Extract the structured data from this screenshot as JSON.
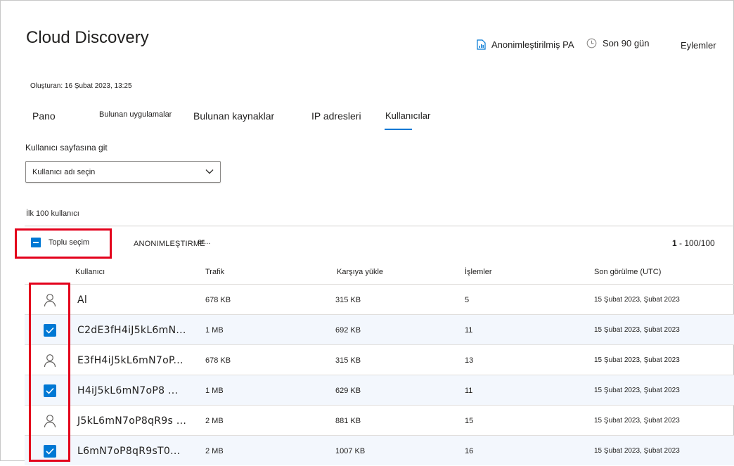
{
  "page": {
    "title": "Cloud Discovery",
    "created": "Oluşturan: 16 Şubat 2023, 13:25"
  },
  "header": {
    "report_label": "Anonimleştirilmiş PA",
    "period_label": "Son 90 gün",
    "actions_label": "Eylemler"
  },
  "tabs": [
    {
      "label": "Pano"
    },
    {
      "label": "Bulunan uygulamalar"
    },
    {
      "label": "Bulunan kaynaklar"
    },
    {
      "label": "IP adresleri"
    },
    {
      "label": "Kullanıcılar",
      "active": true
    }
  ],
  "goto": {
    "label": "Kullanıcı sayfasına git",
    "select_value": "Kullanıcı adı seçin"
  },
  "list": {
    "heading": "İlk 100 kullanıcı",
    "bulk_select_label": "Toplu seçim",
    "anonymize_label": "ANONIMLEŞTIRME",
    "more_fragment": "er...",
    "pager_current": "1",
    "pager_rest": " - 100/100"
  },
  "columns": {
    "user": "Kullanıcı",
    "traffic": "Trafik",
    "upload": "Karşıya yükle",
    "transactions": "İşlemler",
    "last_seen": "Son görülme (UTC)"
  },
  "rows": [
    {
      "user": "Al",
      "traffic": "678 KB",
      "upload": "315 KB",
      "transactions": "5",
      "last_seen": "15 Şubat 2023, Şubat 2023",
      "selected": false
    },
    {
      "user": "C2dE3fH4iJ5kL6mN...",
      "traffic": "1 MB",
      "upload": "692 KB",
      "transactions": "11",
      "last_seen": "15 Şubat 2023, Şubat 2023",
      "selected": true
    },
    {
      "user": "E3fH4iJ5kL6mN7oP...",
      "traffic": "678 KB",
      "upload": "315 KB",
      "transactions": "13",
      "last_seen": "15 Şubat 2023, Şubat 2023",
      "selected": false
    },
    {
      "user": "H4iJ5kL6mN7oP8 ...",
      "traffic": "1 MB",
      "upload": "629 KB",
      "transactions": "11",
      "last_seen": "15 Şubat 2023, Şubat 2023",
      "selected": true
    },
    {
      "user": "J5kL6mN7oP8qR9s ...",
      "traffic": "2 MB",
      "upload": "881 KB",
      "transactions": "15",
      "last_seen": "15 Şubat 2023, Şubat 2023",
      "selected": false
    },
    {
      "user": "L6mN7oP8qR9sT0...",
      "traffic": "2 MB",
      "upload": "1007 KB",
      "transactions": "16",
      "last_seen": "15 Şubat 2023, Şubat 2023",
      "selected": true
    }
  ],
  "colors": {
    "accent": "#0078d4",
    "highlight": "#e3001b",
    "selected_row": "#f3f7fd"
  }
}
